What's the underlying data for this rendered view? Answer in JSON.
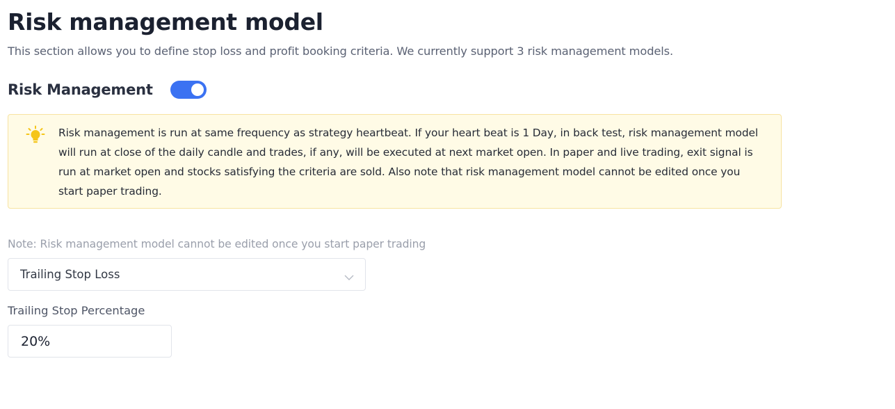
{
  "header": {
    "title": "Risk management model",
    "subtitle": "This section allows you to define stop loss and profit booking criteria. We currently support 3 risk management models."
  },
  "risk_management": {
    "label": "Risk Management",
    "enabled": true,
    "toggle_color": "#3b72f2"
  },
  "info_box": {
    "icon": "lightbulb-icon",
    "icon_color": "#f5c518",
    "text": "Risk management is run at same frequency as strategy heartbeat. If your heart beat is 1 Day, in back test, risk management model will run at close of the daily candle and trades, if any, will be executed at next market open. In paper and live trading, exit signal is run at market open and stocks satisfying the criteria are sold. Also note that risk management model cannot be edited once you start paper trading.",
    "background_color": "#fffbe6",
    "border_color": "#f7e3a1"
  },
  "model_select": {
    "note": "Note: Risk management model cannot be edited once you start paper trading",
    "selected": "Trailing Stop Loss",
    "icon": "chevron-down-icon"
  },
  "trailing_stop": {
    "label": "Trailing Stop Percentage",
    "value": "20%"
  }
}
